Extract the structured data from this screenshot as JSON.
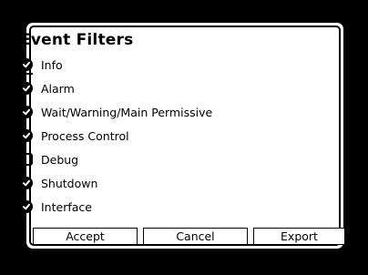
{
  "dialog": {
    "title": "Event Filters",
    "filters": [
      {
        "label": "Info",
        "checked": true
      },
      {
        "label": "Alarm",
        "checked": true
      },
      {
        "label": "Wait/Warning/Main Permissive",
        "checked": true
      },
      {
        "label": "Process Control",
        "checked": true
      },
      {
        "label": "Debug",
        "checked": false
      },
      {
        "label": "Shutdown",
        "checked": true
      },
      {
        "label": "Interface",
        "checked": true
      }
    ],
    "buttons": {
      "accept": "Accept",
      "cancel": "Cancel",
      "export": "Export"
    }
  }
}
